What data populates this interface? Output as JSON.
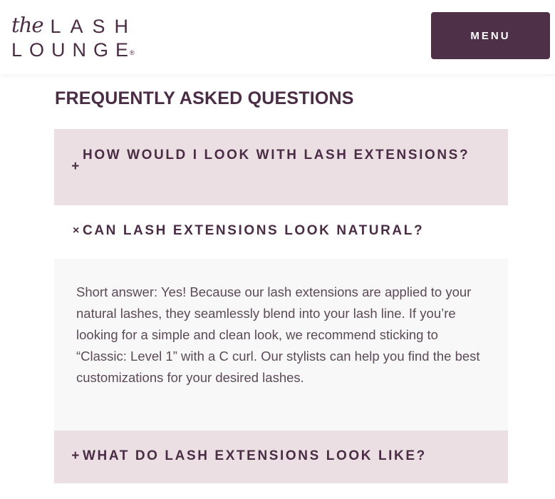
{
  "header": {
    "logo_the": "the",
    "logo_lash": "LASH",
    "logo_lounge": "LOUNGE",
    "logo_reg": "®",
    "menu_label": "MENU"
  },
  "faq": {
    "title": "FREQUENTLY ASKED QUESTIONS",
    "items": [
      {
        "icon": "plus-icon",
        "symbol": "+",
        "question": "HOW WOULD I LOOK WITH LASH EXTENSIONS?",
        "expanded": false
      },
      {
        "icon": "close-icon",
        "symbol": "×",
        "question": "CAN LASH EXTENSIONS LOOK NATURAL?",
        "expanded": true,
        "answer": "Short answer: Yes! Because our lash extensions are applied to your natural lashes, they seamlessly blend into your lash line. If you’re looking for a simple and clean look, we recommend sticking to “Classic: Level 1” with a C curl. Our stylists can help you find the best customizations for your desired lashes."
      },
      {
        "icon": "plus-icon",
        "symbol": "+",
        "question": "WHAT DO LASH EXTENSIONS LOOK LIKE?",
        "expanded": false
      }
    ]
  },
  "colors": {
    "brand": "#4a2d45",
    "menu_button": "#4f3049",
    "collapsed_bg": "#ebdfe3",
    "answer_bg": "#f9f8f8"
  }
}
